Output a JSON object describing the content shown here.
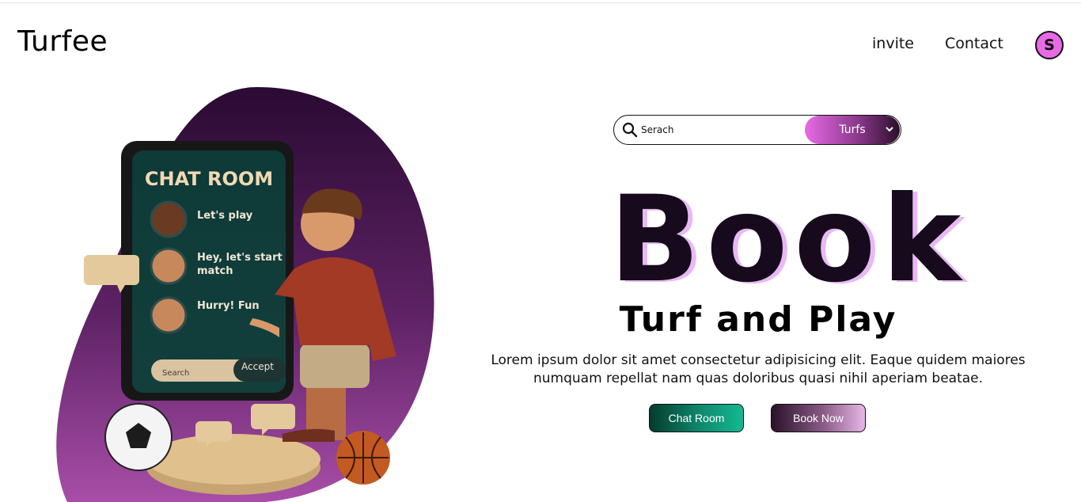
{
  "header": {
    "logo": "Turfee",
    "nav": {
      "invite": "invite",
      "contact": "Contact"
    },
    "avatar_initial": "S"
  },
  "illustration": {
    "phone_title": "CHAT ROOM",
    "messages": [
      "Let's play",
      "Hey, let's start",
      "match",
      "Hurry!  Fun"
    ],
    "phone_search": "Search",
    "phone_accept": "Accept"
  },
  "search": {
    "placeholder": "Serach",
    "select_value": "Turfs"
  },
  "hero": {
    "big_word": "Book",
    "headline": "Turf and Play",
    "description": "Lorem ipsum dolor sit amet consectetur adipisicing elit. Eaque quidem maiores numquam repellat nam quas doloribus quasi nihil aperiam beatae."
  },
  "buttons": {
    "chat_room": "Chat Room",
    "book_now": "Book Now"
  },
  "colors": {
    "accent_pink": "#e86ae6",
    "accent_teal": "#0f8a6e",
    "blob_purple": "#3a1040"
  }
}
